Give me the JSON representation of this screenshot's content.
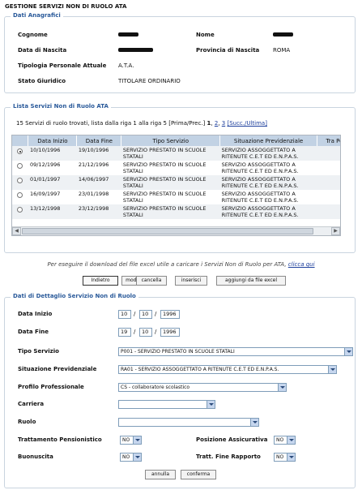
{
  "page_title": "GESTIONE SERVIZI NON DI RUOLO ATA",
  "anagrafici": {
    "legend": "Dati Anagrafici",
    "cognome_label": "Cognome",
    "nome_label": "Nome",
    "data_nascita_label": "Data di Nascita",
    "provincia_label": "Provincia di Nascita",
    "provincia_value": "ROMA",
    "tipologia_label": "Tipologia Personale Attuale",
    "tipologia_value": "A.T.A.",
    "stato_label": "Stato Giuridico",
    "stato_value": "TITOLARE ORDINARIO"
  },
  "lista": {
    "legend": "Lista Servizi Non di Ruolo ATA",
    "summary": "15 Servizi di ruolo trovati, lista dalla riga 1 alla riga 5 [Prima/Prec.]",
    "page_current": "1",
    "page_2": "2",
    "page_3": "3",
    "summary_next": "[Succ./Ultima]",
    "columns": [
      "Data Inizio",
      "Data Fine",
      "Tipo Servizio",
      "Situazione Previdenziale",
      "Tra Pe"
    ],
    "rows": [
      {
        "data_inizio": "10/10/1996",
        "data_fine": "19/10/1996",
        "tipo": "SERVIZIO PRESTATO IN SCUOLE STATALI",
        "situazione": "SERVIZIO ASSOGGETTATO A RITENUTE C.E.T ED E.N.P.A.S.",
        "selected": true
      },
      {
        "data_inizio": "09/12/1996",
        "data_fine": "21/12/1996",
        "tipo": "SERVIZIO PRESTATO IN SCUOLE STATALI",
        "situazione": "SERVIZIO ASSOGGETTATO A RITENUTE C.E.T ED E.N.P.A.S.",
        "selected": false
      },
      {
        "data_inizio": "01/01/1997",
        "data_fine": "14/06/1997",
        "tipo": "SERVIZIO PRESTATO IN SCUOLE STATALI",
        "situazione": "SERVIZIO ASSOGGETTATO A RITENUTE C.E.T ED E.N.P.A.S.",
        "selected": false
      },
      {
        "data_inizio": "16/09/1997",
        "data_fine": "23/01/1998",
        "tipo": "SERVIZIO PRESTATO IN SCUOLE STATALI",
        "situazione": "SERVIZIO ASSOGGETTATO A RITENUTE C.E.T ED E.N.P.A.S.",
        "selected": false
      },
      {
        "data_inizio": "13/12/1998",
        "data_fine": "23/12/1998",
        "tipo": "SERVIZIO PRESTATO IN SCUOLE STATALI",
        "situazione": "SERVIZIO ASSOGGETTATO A RITENUTE C.E.T ED E.N.P.A.S.",
        "selected": false
      }
    ]
  },
  "actions": {
    "indietro": "Indietro",
    "modifica": "modifica",
    "cancella": "cancella",
    "inserisci": "inserisci",
    "excel": "aggiungi da file excel"
  },
  "note": {
    "text": "Per eseguire il download del file excel utile a caricare i Servizi Non di Ruolo per ATA,",
    "link": "clicca qui"
  },
  "dettaglio": {
    "legend": "Dati di Dettaglio Servizio Non di Ruolo",
    "data_inizio_label": "Data Inizio",
    "data_inizio": {
      "d": "10",
      "m": "10",
      "y": "1996"
    },
    "data_fine_label": "Data Fine",
    "data_fine": {
      "d": "19",
      "m": "10",
      "y": "1996"
    },
    "date_sep": "/",
    "tipo_servizio_label": "Tipo Servizio",
    "tipo_servizio_value": "P001 - SERVIZIO PRESTATO IN SCUOLE STATALI",
    "situazione_label": "Situazione Previdenziale",
    "situazione_value": "RA01 - SERVIZIO ASSOGGETTATO A RITENUTE C.E.T ED E.N.P.A.S.",
    "profilo_label": "Profilo Professionale",
    "profilo_value": "CS - collaboratore scolastico",
    "carriera_label": "Carriera",
    "carriera_value": "",
    "ruolo_label": "Ruolo",
    "ruolo_value": "",
    "trattamento_label": "Trattamento Pensionistico",
    "trattamento_value": "NO",
    "posizione_label": "Posizione Assicurativa",
    "posizione_value": "NO",
    "buonuscita_label": "Buonuscita",
    "buonuscita_value": "NO",
    "tratt_fine_label": "Tratt. Fine Rapporto",
    "tratt_fine_value": "NO",
    "annulla": "annulla",
    "conferma": "conferma"
  }
}
